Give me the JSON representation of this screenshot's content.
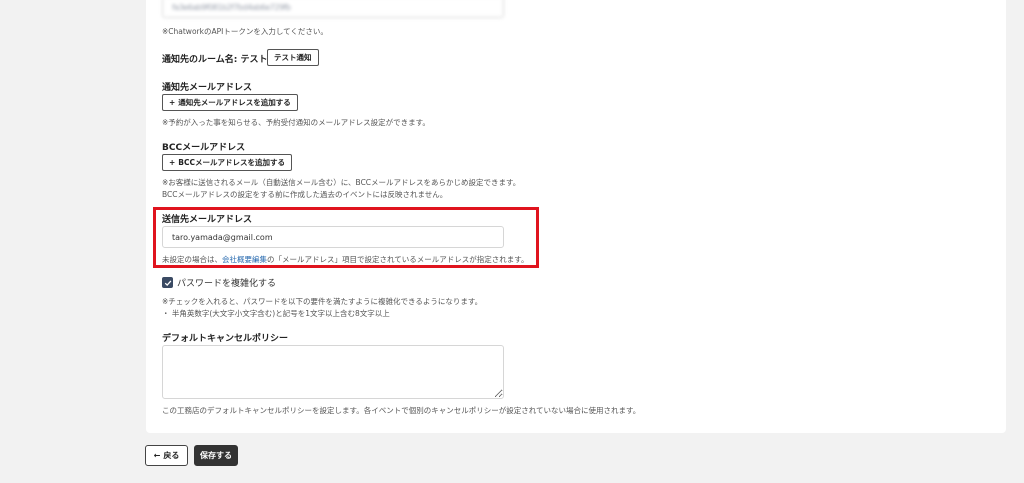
{
  "api_token": {
    "value": "fa3e6ab9f081b2f7bd4ab6e729fb",
    "note": "※ChatworkのAPIトークンを入力してください。"
  },
  "room": {
    "label": "通知先のルーム名: テスト",
    "test_button": "テスト通知"
  },
  "notify_email": {
    "label": "通知先メールアドレス",
    "add_button_icon": "+",
    "add_button": "通知先メールアドレスを追加する",
    "note": "※予約が入った事を知らせる、予約受付通知のメールアドレス設定ができます。"
  },
  "bcc_email": {
    "label": "BCCメールアドレス",
    "add_button_icon": "+",
    "add_button": "BCCメールアドレスを追加する",
    "note_line1": "※お客様に送信されるメール（自動送信メール含む）に、BCCメールアドレスをあらかじめ設定できます。",
    "note_line2": "BCCメールアドレスの設定をする前に作成した過去のイベントには反映されません。"
  },
  "sender_email": {
    "label": "送信先メールアドレス",
    "value": "taro.yamada@gmail.com",
    "note_prefix": "未設定の場合は、",
    "note_link": "会社概要編集",
    "note_suffix": "の「メールアドレス」項目で設定されているメールアドレスが指定されます。"
  },
  "password": {
    "checkbox_label": "パスワードを複雑化する",
    "checked": true,
    "note_line1": "※チェックを入れると、パスワードを以下の要件を満たすように複雑化できるようになります。",
    "note_line2": "・ 半角英数字(大文字小文字含む)と記号を1文字以上含む8文字以上"
  },
  "cancel_policy": {
    "label": "デフォルトキャンセルポリシー",
    "value": "",
    "note": "この工務店のデフォルトキャンセルポリシーを設定します。各イベントで個別のキャンセルポリシーが設定されていない場合に使用されます。"
  },
  "footer": {
    "back_icon": "←",
    "back_label": "戻る",
    "save_label": "保存する"
  },
  "colors": {
    "highlight": "#e0141e",
    "link": "#2b6cb0",
    "save_button": "#333333"
  }
}
